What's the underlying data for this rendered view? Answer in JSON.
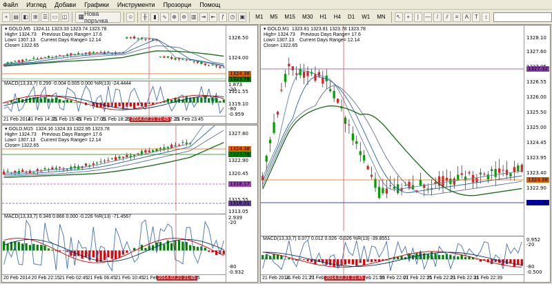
{
  "menu": [
    "Файл",
    "Изглед",
    "Добави",
    "Графики",
    "Инструменти",
    "Прозорци",
    "Помощ"
  ],
  "toolbar": {
    "new_order": "Нова поръчка",
    "timeframes": [
      "M1",
      "M5",
      "M15",
      "M30",
      "H1",
      "H4",
      "D1",
      "W1",
      "MN"
    ]
  },
  "charts": [
    {
      "header": "GOLD,M5  1324.11 1323.33 1323.74 1323.78",
      "info": [
        "High= 1324.73    Previous Days Range= 17.6",
        "Low= 1307.13    Current Days Range= 12.14",
        "Close= 1322.65"
      ],
      "prices": [
        "1326.50",
        "1324.00",
        "1321.55",
        "1319.10"
      ],
      "tags": [
        {
          "text": "1324.38",
          "color": "#e06000"
        },
        {
          "text": "1323.78",
          "color": "#008000"
        }
      ],
      "macd_label": "MACD(13,33,7) 0.299 -0.004 0.005 0.000  %R(13) -24.4444",
      "ind_scale": [
        "1.873",
        "-20",
        "-80",
        "-0.959"
      ],
      "times": [
        "21 Feb 2014",
        "21 Feb 14:25",
        "21 Feb 15:45",
        "21 Feb 17:05",
        "21 Feb 18:25",
        "21 Feb 19:45",
        "21 Feb 22:25",
        "21 Feb 23:45"
      ],
      "cursor_time": "2014.02.21 21:45"
    },
    {
      "header": "GOLD,M15  1324.16 1324.33 1322.95 1323.78",
      "info": [
        "High= 1324.73    Previous Days Range= 17.6",
        "Low= 1307.13    Current Days Range= 12.14",
        "Close= 1322.65"
      ],
      "prices": [
        "1327.80",
        "1325.35",
        "1322.90",
        "1320.45",
        "1315.55",
        "1313.05"
      ],
      "tags": [
        {
          "text": "1324.38",
          "color": "#e06000"
        },
        {
          "text": "1323.78",
          "color": "#008000"
        },
        {
          "text": "1318.17",
          "color": "#a040c0"
        },
        {
          "text": "1316.01",
          "color": "#6040a0"
        }
      ],
      "macd_label": "MACD(13,33,7) 0.346 0.866 0.000 -0.226  %R(13) -71.4567",
      "ind_scale": [
        "2.939",
        "-20",
        "-80",
        "-0.932"
      ],
      "times": [
        "20 Feb 2014",
        "20 Feb 22:15",
        "21 Feb 02:45",
        "21 Feb 06:45",
        "21 Feb 10:45",
        "21 Feb 14:45",
        "21 Feb 22:45"
      ],
      "cursor_time": "2014.02.21 21:45"
    },
    {
      "header": "GOLD,M1  1323.81 1323.81 1323.78 1323.78",
      "info": [
        "High= 1324.73    Previous Days Range= 17.6",
        "Low= 1307.13    Current Days Range= 12.14",
        "Close= 1322.65"
      ],
      "prices": [
        "1328.10",
        "1327.60",
        "1327.05",
        "1326.55",
        "1326.00",
        "1325.50",
        "1325.00",
        "1324.45",
        "1323.95",
        "1323.40",
        "1322.90"
      ],
      "tags": [
        {
          "text": "1327.32",
          "color": "#8040a0"
        },
        {
          "text": "1324.38",
          "color": "#e06000"
        },
        {
          "text": "1323.78",
          "color": "#0000a0"
        }
      ],
      "macd_label": "MACD(13,33,7) 0.077 0.012 0.026 -0.026  %R(13) -39.8551",
      "ind_scale": [
        "0.952",
        "-20",
        "-80",
        "-0.500"
      ],
      "times": [
        "21 Feb 2014",
        "21 Feb 21:27",
        "21 Feb 21:35",
        "21 Feb 21:51",
        "21 Feb 21:59",
        "21 Feb 22:07",
        "21 Feb 22:15",
        "21 Feb 22:23",
        "21 Feb 22:31",
        "21 Feb 22:39"
      ],
      "cursor_time": "2014.02.21 21:45"
    }
  ]
}
